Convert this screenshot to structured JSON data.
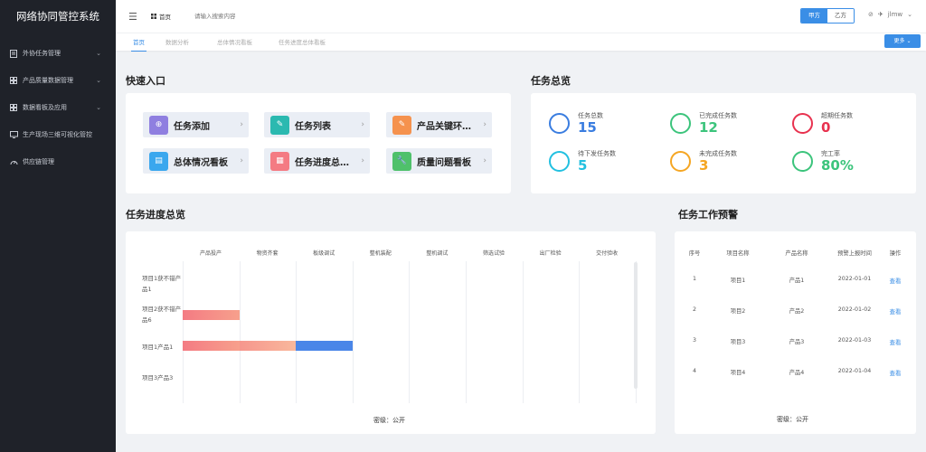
{
  "sidebar": {
    "title": "网络协同管控系统",
    "items": [
      {
        "label": "外协任务管理",
        "icon": "document-icon",
        "has_children": true
      },
      {
        "label": "产品质量数据管理",
        "icon": "grid-icon",
        "has_children": true
      },
      {
        "label": "数据看板及应用",
        "icon": "grid-icon",
        "has_children": true
      },
      {
        "label": "生产现场三维可视化管控",
        "icon": "monitor-icon",
        "has_children": false
      },
      {
        "label": "供应链管理",
        "icon": "gauge-icon",
        "has_children": false
      }
    ]
  },
  "topbar": {
    "home": "首页",
    "search_placeholder": "请输入搜索内容",
    "party_a": "甲方",
    "party_b": "乙方",
    "user": "jlmw"
  },
  "tabs": [
    "首页",
    "数据分析",
    "总体情况看板",
    "任务进度总体看板"
  ],
  "more_label": "更多",
  "quick_entry": {
    "title": "快速入口",
    "items": [
      {
        "label": "任务添加",
        "icon": "plus-circle-icon",
        "color": "#8f7fe0"
      },
      {
        "label": "任务列表",
        "icon": "edit-icon",
        "color": "#2bb9b0"
      },
      {
        "label": "产品关键环节…",
        "icon": "edit-icon",
        "color": "#f5924e"
      },
      {
        "label": "总体情况看板",
        "icon": "document-icon",
        "color": "#3aa7ee"
      },
      {
        "label": "任务进度总体…",
        "icon": "grid-icon",
        "color": "#f47b83"
      },
      {
        "label": "质量问题看板",
        "icon": "wrench-icon",
        "color": "#4fc16b"
      }
    ]
  },
  "overview": {
    "title": "任务总览",
    "items": [
      {
        "label": "任务总数",
        "value": "15",
        "color": "#3a7de0"
      },
      {
        "label": "已完成任务数",
        "value": "12",
        "color": "#3cc47c"
      },
      {
        "label": "超期任务数",
        "value": "0",
        "color": "#e8324f"
      },
      {
        "label": "待下发任务数",
        "value": "5",
        "color": "#22c0e0"
      },
      {
        "label": "未完成任务数",
        "value": "3",
        "color": "#f5a623"
      },
      {
        "label": "完工率",
        "value": "80%",
        "color": "#3cc47c"
      }
    ]
  },
  "progress": {
    "title": "任务进度总览",
    "stages": [
      "产品投产",
      "物资齐套",
      "板级调试",
      "整机装配",
      "整机调试",
      "筛选试验",
      "出厂检验",
      "交付验收"
    ],
    "rows": [
      {
        "label": "项目1获不错产品1",
        "completed_stages": 0,
        "bar_colors": []
      },
      {
        "label": "项目2获不错产品6",
        "completed_stages": 1,
        "bar_colors": [
          "#f47b83"
        ]
      },
      {
        "label": "项目1产品1",
        "completed_stages": 3,
        "bar_colors": [
          "#f47b83",
          "#f7a08c",
          "#4a86e8"
        ]
      },
      {
        "label": "项目3产品3",
        "completed_stages": 0,
        "bar_colors": []
      }
    ],
    "footer": "密级：公开"
  },
  "warning": {
    "title": "任务工作预警",
    "headers": [
      "序号",
      "项目名称",
      "产品名称",
      "预警上报时间",
      "操作"
    ],
    "rows": [
      {
        "no": "1",
        "project": "项目1",
        "product": "产品1",
        "date": "2022-01-01",
        "action": "查看"
      },
      {
        "no": "2",
        "project": "项目2",
        "product": "产品2",
        "date": "2022-01-02",
        "action": "查看"
      },
      {
        "no": "3",
        "project": "项目3",
        "product": "产品3",
        "date": "2022-01-03",
        "action": "查看"
      },
      {
        "no": "4",
        "project": "项目4",
        "product": "产品4",
        "date": "2022-01-04",
        "action": "查看"
      }
    ],
    "footer": "密级：公开"
  }
}
